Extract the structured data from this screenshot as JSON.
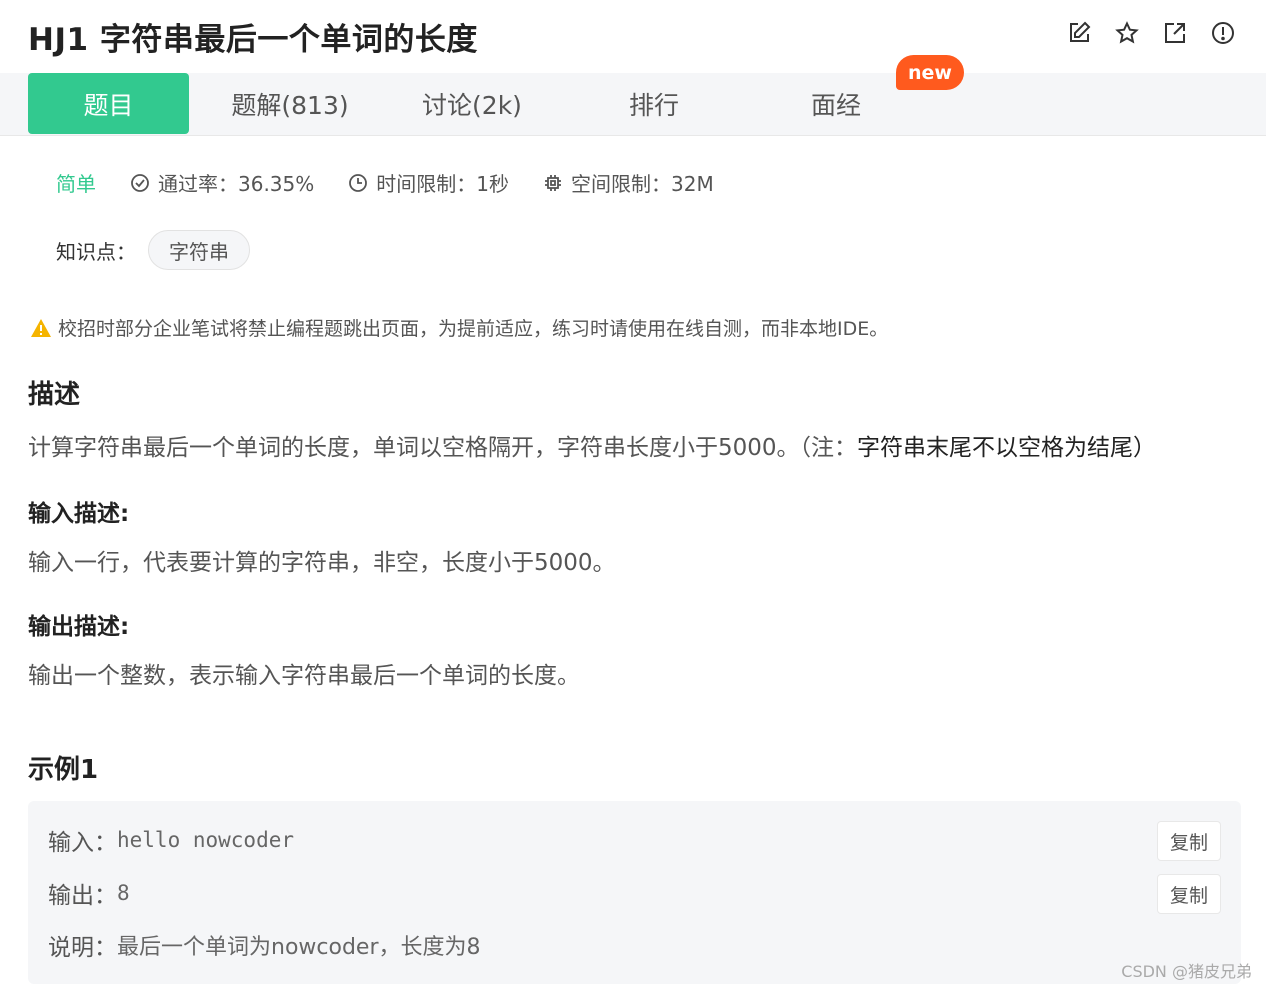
{
  "header": {
    "title": "HJ1  字符串最后一个单词的长度",
    "icons": [
      "edit-icon",
      "star-icon",
      "external-link-icon",
      "info-icon"
    ]
  },
  "tabs": [
    {
      "label": "题目",
      "active": true
    },
    {
      "label": "题解(813)"
    },
    {
      "label": "讨论(2k)"
    },
    {
      "label": "排行"
    },
    {
      "label": "面经"
    }
  ],
  "badge": {
    "new": "new"
  },
  "meta": {
    "difficulty": "简单",
    "pass_rate": "通过率：36.35%",
    "time_limit": "时间限制：1秒",
    "space_limit": "空间限制：32M"
  },
  "knowledge": {
    "label": "知识点：",
    "tag": "字符串"
  },
  "warning": "校招时部分企业笔试将禁止编程题跳出页面，为提前适应，练习时请使用在线自测，而非本地IDE。",
  "description": {
    "heading": "描述",
    "text": "计算字符串最后一个单词的长度，单词以空格隔开，字符串长度小于5000。（注：",
    "note": "字符串末尾不以空格为结尾）"
  },
  "input_desc": {
    "heading": "输入描述:",
    "text": "输入一行，代表要计算的字符串，非空，长度小于5000。"
  },
  "output_desc": {
    "heading": "输出描述:",
    "text": "输出一个整数，表示输入字符串最后一个单词的长度。"
  },
  "example": {
    "heading": "示例1",
    "input_label": "输入：",
    "input_value": "hello nowcoder",
    "output_label": "输出：",
    "output_value": "8",
    "explain_label": "说明：",
    "explain_value": "最后一个单词为nowcoder，长度为8",
    "copy_label": "复制"
  },
  "watermark": "CSDN @猪皮兄弟",
  "colors": {
    "accent": "#32c98f",
    "badge": "#ff5a1e"
  }
}
